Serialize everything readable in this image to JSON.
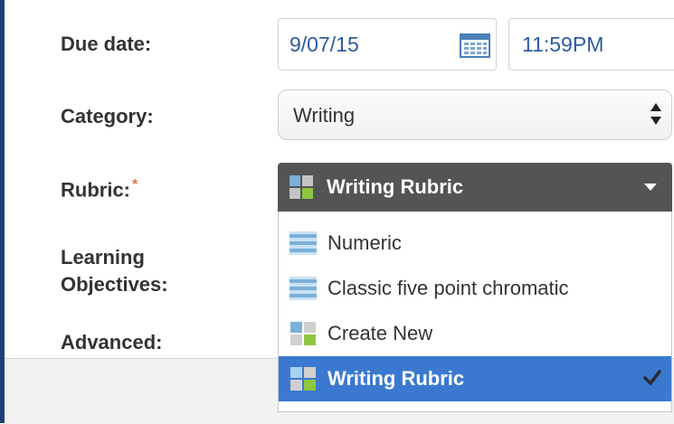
{
  "form": {
    "due_date_label": "Due date:",
    "due_date_value": "9/07/15",
    "due_time_value": "11:59PM",
    "category_label": "Category:",
    "category_value": "Writing",
    "rubric_label": "Rubric:",
    "rubric_required_marker": "*",
    "learning_objectives_label_line1": "Learning",
    "learning_objectives_label_line2": "Objectives:",
    "advanced_label": "Advanced:"
  },
  "rubric_dropdown": {
    "selected_label": "Writing Rubric",
    "options": [
      {
        "label": "Numeric",
        "icon": "rubric-list-icon"
      },
      {
        "label": "Classic five point chromatic",
        "icon": "rubric-list-icon"
      },
      {
        "label": "Create New",
        "icon": "rubric-grid-icon"
      },
      {
        "label": "Writing Rubric",
        "icon": "rubric-grid-icon",
        "selected": true
      }
    ]
  },
  "colors": {
    "label_text": "#333333",
    "input_text": "#2c5aa0",
    "dropdown_header_bg": "#545454",
    "selected_option_bg": "#3b79d1",
    "required_marker": "#e8734a",
    "grid_icon_blue": "#7ab0d9",
    "grid_icon_green": "#8dc63f"
  }
}
